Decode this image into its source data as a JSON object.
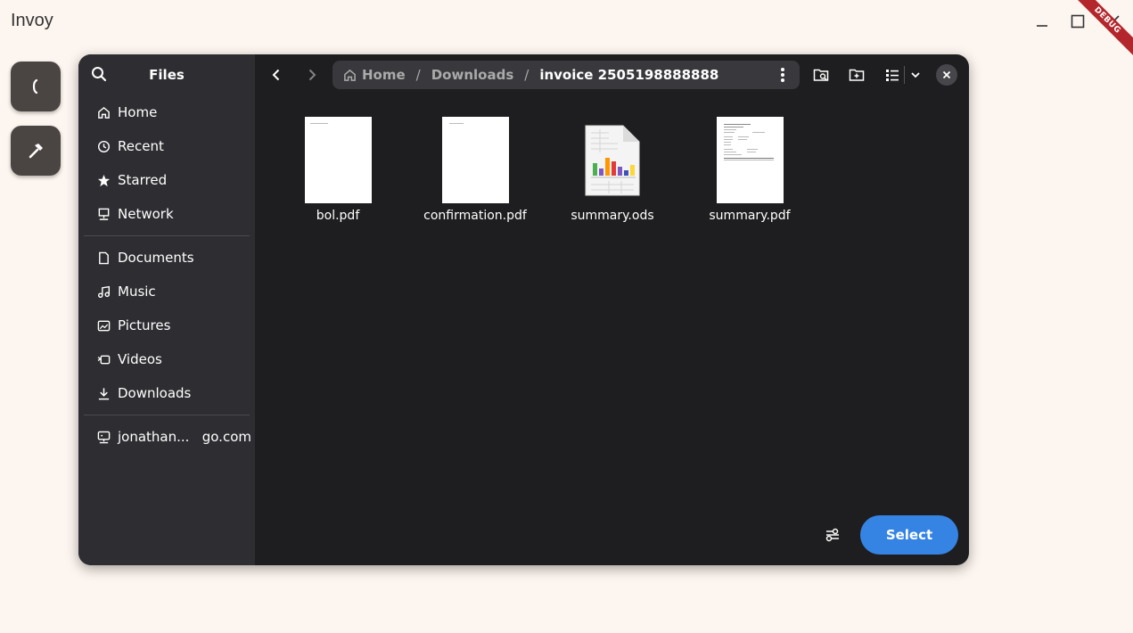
{
  "app": {
    "title": "Invoy",
    "debug_label": "DEBUG"
  },
  "dialog": {
    "sidebar": {
      "title": "Files",
      "places": [
        {
          "label": "Home",
          "icon": "home-icon"
        },
        {
          "label": "Recent",
          "icon": "clock-icon"
        },
        {
          "label": "Starred",
          "icon": "star-icon"
        },
        {
          "label": "Network",
          "icon": "network-icon"
        }
      ],
      "bookmarks": [
        {
          "label": "Documents",
          "icon": "document-icon"
        },
        {
          "label": "Music",
          "icon": "music-icon"
        },
        {
          "label": "Pictures",
          "icon": "picture-icon"
        },
        {
          "label": "Videos",
          "icon": "video-icon"
        },
        {
          "label": "Downloads",
          "icon": "download-icon"
        }
      ],
      "remote": [
        {
          "label": "jonathan...   go.com",
          "icon": "remote-icon"
        }
      ]
    },
    "path": {
      "home": "Home",
      "segments": [
        "Downloads",
        "invoice 2505198888888"
      ],
      "separator": "/"
    },
    "files": [
      {
        "name": "bol.pdf",
        "type": "pdf"
      },
      {
        "name": "confirmation.pdf",
        "type": "pdf"
      },
      {
        "name": "summary.ods",
        "type": "spreadsheet"
      },
      {
        "name": "summary.pdf",
        "type": "pdf-rich"
      }
    ],
    "select_label": "Select",
    "accent": "#3584e4"
  }
}
